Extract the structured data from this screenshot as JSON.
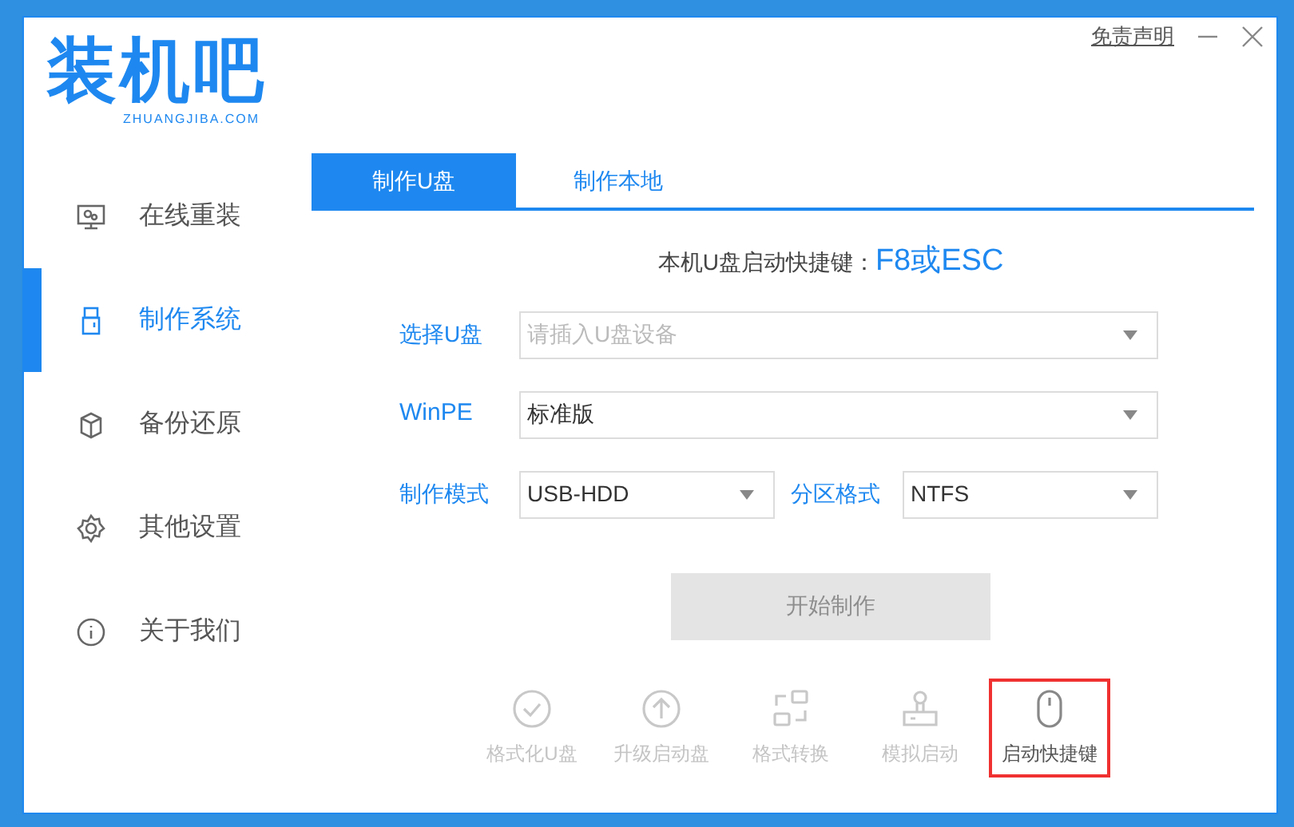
{
  "header": {
    "logo": "装机吧",
    "logo_sub": "ZHUANGJIBA.COM",
    "disclaimer_link": "免责声明"
  },
  "sidebar": {
    "items": [
      {
        "label": "在线重装",
        "kind": "monitor",
        "selected": false
      },
      {
        "label": "制作系统",
        "kind": "usb",
        "selected": true
      },
      {
        "label": "备份还原",
        "kind": "backup",
        "selected": false
      },
      {
        "label": "其他设置",
        "kind": "gear",
        "selected": false
      },
      {
        "label": "关于我们",
        "kind": "info",
        "selected": false
      }
    ]
  },
  "tabs": [
    {
      "label": "制作U盘",
      "selected": true
    },
    {
      "label": "制作本地",
      "selected": false
    }
  ],
  "hotkey": {
    "label": "本机U盘启动快捷键：",
    "value": "F8或ESC"
  },
  "form": {
    "usb_label": "选择U盘",
    "usb_placeholder": "请插入U盘设备",
    "winpe_label": "WinPE",
    "winpe_value": "标准版",
    "mode_label": "制作模式",
    "mode_value": "USB-HDD",
    "partition_label": "分区格式",
    "partition_value": "NTFS"
  },
  "start_button": {
    "label": "开始制作",
    "disabled": true
  },
  "tools": [
    {
      "label": "格式化U盘",
      "kind": "check",
      "disabled": true,
      "highlighted": false
    },
    {
      "label": "升级启动盘",
      "kind": "up",
      "disabled": true,
      "highlighted": false
    },
    {
      "label": "格式转换",
      "kind": "convert",
      "disabled": true,
      "highlighted": false
    },
    {
      "label": "模拟启动",
      "kind": "stamp",
      "disabled": true,
      "highlighted": false
    },
    {
      "label": "启动快捷键",
      "kind": "mouse",
      "disabled": false,
      "highlighted": true
    }
  ]
}
